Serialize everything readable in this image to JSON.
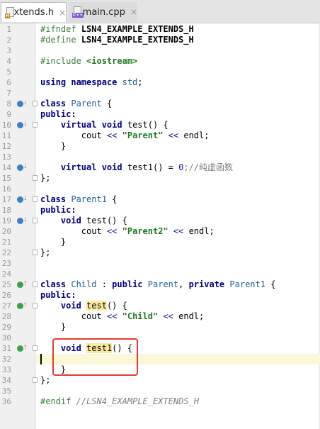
{
  "tabs": [
    {
      "label": "Extends.h",
      "icon_tag": "H",
      "close": "×",
      "active": true
    },
    {
      "label": "main.cpp",
      "icon_tag": "C++",
      "close": "×",
      "active": false
    }
  ],
  "lines": [
    "1",
    "2",
    "3",
    "4",
    "5",
    "6",
    "7",
    "8",
    "9",
    "10",
    "11",
    "12",
    "13",
    "14",
    "15",
    "16",
    "17",
    "18",
    "19",
    "20",
    "21",
    "22",
    "23",
    "24",
    "25",
    "26",
    "27",
    "28",
    "29",
    "30",
    "31",
    "32",
    "33",
    "34",
    "35",
    "36"
  ],
  "code": {
    "ifndef_kw": "#ifndef",
    "ifndef_macro": "LSN4_EXAMPLE_EXTENDS_H",
    "define_kw": "#define",
    "define_macro": "LSN4_EXAMPLE_EXTENDS_H",
    "include_kw": "#include",
    "include_file": "<iostream>",
    "using": "using namespace",
    "std": "std",
    "semi": ";",
    "class_kw": "class",
    "parent": "Parent",
    "parent1": "Parent1",
    "child": "Child",
    "open_brace": "{",
    "close_brace": "}",
    "close_brace_semi": "};",
    "public": "public:",
    "public_kw": "public",
    "private_kw": "private",
    "virtual_void": "virtual void",
    "void": "void",
    "test": "test",
    "test1": "test1",
    "parens_brace": "() {",
    "parens": "()",
    "eq": " = ",
    "zero": "0",
    "semi_comment": ";//纯虚函数",
    "cout": "cout",
    "shl": "<<",
    "endl": "endl;",
    "str_parent": "\"Parent\"",
    "str_parent2": "\"Parent2\"",
    "str_child": "\"Child\"",
    "colon": " : ",
    "comma": ", ",
    "endif_kw": "#endif",
    "endif_comment": "//LSN4_EXAMPLE_EXTENDS_H"
  },
  "colors": {
    "keyword": "#00007f",
    "string": "#1f7a1f",
    "identifier": "#20609a",
    "preprocessor": "#3f7f3f",
    "highlight_box": "#e53b2e"
  },
  "markers": {
    "implemented": "implemented-icon",
    "overriding": "overriding-icon"
  }
}
